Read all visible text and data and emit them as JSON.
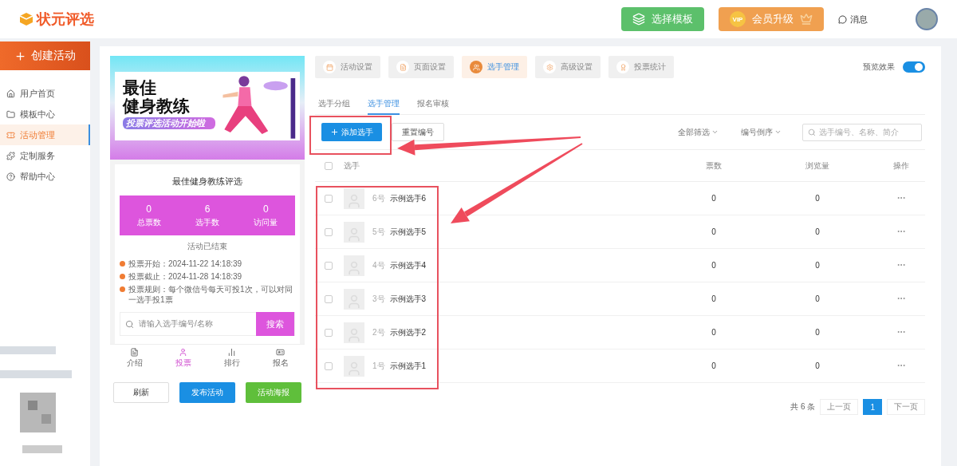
{
  "header": {
    "logo": "状元评选",
    "template_button": "选择模板",
    "vip_button": {
      "badge": "VIP",
      "label": "会员升级"
    },
    "messages": "消息"
  },
  "sidebar": {
    "create_button": "创建活动",
    "items": [
      {
        "label": "用户首页",
        "selected": false
      },
      {
        "label": "模板中心",
        "selected": false
      },
      {
        "label": "活动管理",
        "selected": true
      },
      {
        "label": "定制服务",
        "selected": false
      },
      {
        "label": "帮助中心",
        "selected": false
      }
    ]
  },
  "preview": {
    "banner": {
      "title_lines": [
        "最佳",
        "健身教练"
      ],
      "tagline": "投票评选活动开始啦"
    },
    "title": "最佳健身教练评选",
    "stats": [
      {
        "value": "0",
        "label": "总票数"
      },
      {
        "value": "6",
        "label": "选手数"
      },
      {
        "value": "0",
        "label": "访问量"
      }
    ],
    "status": "活动已结束",
    "info": [
      "投票开始：2024-11-22 14:18:39",
      "投票截止：2024-11-28 14:18:39",
      "投票规则：每个微信号每天可投1次，可以对同一选手投1票"
    ],
    "search": {
      "placeholder": "请输入选手编号/名称",
      "button": "搜索"
    },
    "bottom_nav": [
      {
        "label": "介绍",
        "selected": false
      },
      {
        "label": "投票",
        "selected": true
      },
      {
        "label": "排行",
        "selected": false
      },
      {
        "label": "报名",
        "selected": false
      }
    ],
    "actions": [
      "刷新",
      "发布活动",
      "活动海报"
    ]
  },
  "manager": {
    "tabs": [
      {
        "label": "活动设置",
        "selected": false
      },
      {
        "label": "页面设置",
        "selected": false
      },
      {
        "label": "选手管理",
        "selected": true
      },
      {
        "label": "高级设置",
        "selected": false
      },
      {
        "label": "投票统计",
        "selected": false
      }
    ],
    "preview_toggle": {
      "label": "预览效果",
      "on": true
    },
    "subtabs": [
      {
        "label": "选手分组",
        "selected": false
      },
      {
        "label": "选手管理",
        "selected": true
      },
      {
        "label": "报名审核",
        "selected": false
      }
    ],
    "toolbar": {
      "add_button": "添加选手",
      "renumber_button": "重置编号",
      "filter": "全部筛选",
      "sort": "编号倒序",
      "search_placeholder": "选手编号、名称、简介"
    },
    "table": {
      "select_all_checked": false,
      "columns": [
        "选手",
        "票数",
        "浏览量",
        "操作"
      ],
      "rows": [
        {
          "number": "6号",
          "name": "示例选手6",
          "votes": "0",
          "views": "0",
          "checked": false
        },
        {
          "number": "5号",
          "name": "示例选手5",
          "votes": "0",
          "views": "0",
          "checked": false
        },
        {
          "number": "4号",
          "name": "示例选手4",
          "votes": "0",
          "views": "0",
          "checked": false
        },
        {
          "number": "3号",
          "name": "示例选手3",
          "votes": "0",
          "views": "0",
          "checked": false
        },
        {
          "number": "2号",
          "name": "示例选手2",
          "votes": "0",
          "views": "0",
          "checked": false
        },
        {
          "number": "1号",
          "name": "示例选手1",
          "votes": "0",
          "views": "0",
          "checked": false
        }
      ]
    },
    "pagination": {
      "total": "共 6 条",
      "prev": "上一页",
      "pages": [
        {
          "label": "1",
          "selected": true
        }
      ],
      "next": "下一页"
    }
  }
}
